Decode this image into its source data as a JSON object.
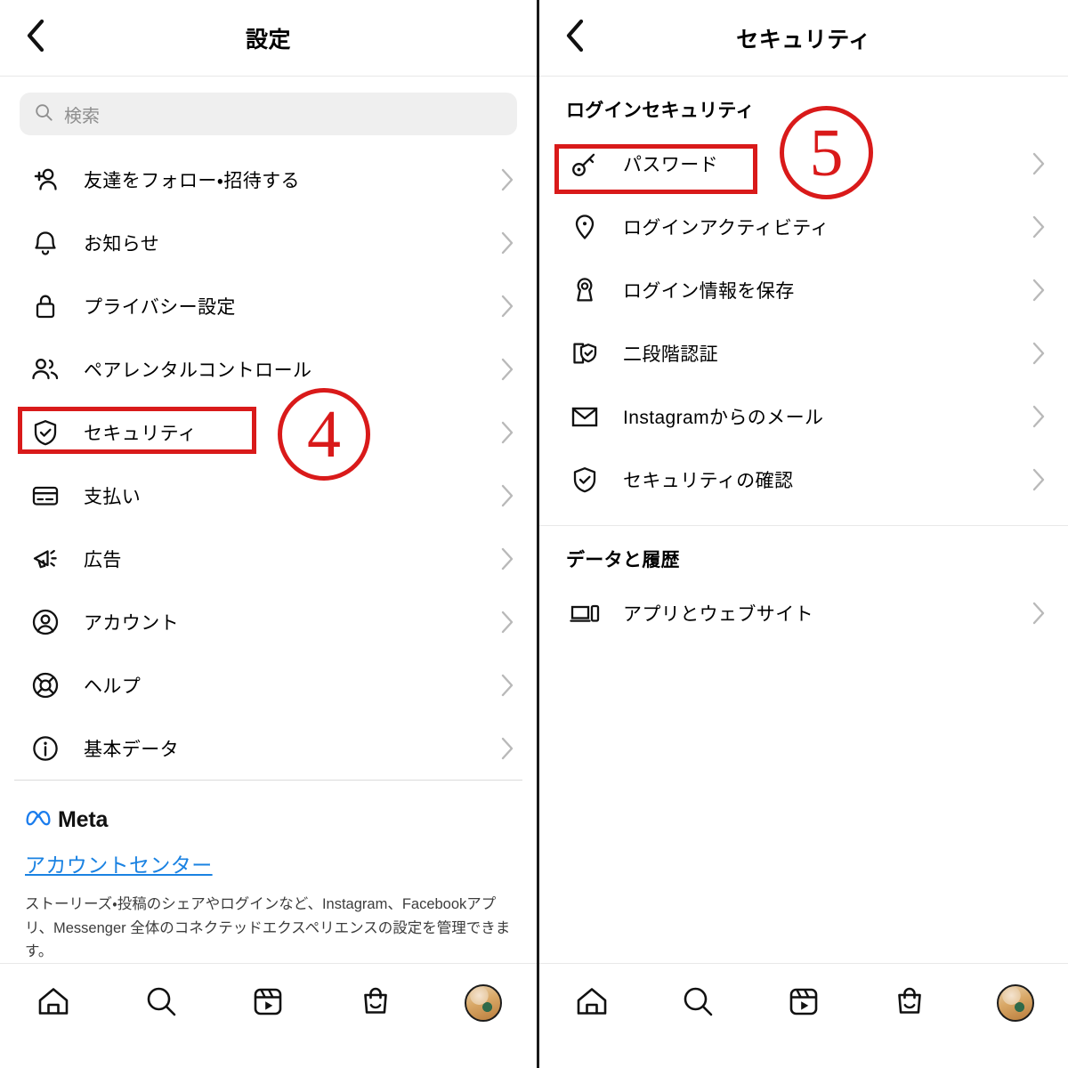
{
  "colors": {
    "annotation_red": "#d91a1a",
    "link_blue": "#1a82e2",
    "meta_blue": "#1a7ced",
    "search_bg": "#efefef",
    "placeholder": "#8e8e8e"
  },
  "left_screen": {
    "header": {
      "title": "設定",
      "back_icon": "chevron-left-icon"
    },
    "search": {
      "placeholder": "検索",
      "value": "",
      "icon": "search-icon"
    },
    "items": [
      {
        "label": "友達をフォロー・招待する",
        "icon": "person-add-icon"
      },
      {
        "label": "お知らせ",
        "icon": "bell-icon"
      },
      {
        "label": "プライバシー設定",
        "icon": "lock-icon"
      },
      {
        "label": "ペアレンタルコントロール",
        "icon": "people-icon"
      },
      {
        "label": "セキュリティ",
        "icon": "shield-check-icon"
      },
      {
        "label": "支払い",
        "icon": "credit-card-icon"
      },
      {
        "label": "広告",
        "icon": "megaphone-icon"
      },
      {
        "label": "アカウント",
        "icon": "account-circle-icon"
      },
      {
        "label": "ヘルプ",
        "icon": "life-ring-icon"
      },
      {
        "label": "基本データ",
        "icon": "info-circle-icon"
      }
    ],
    "meta_section": {
      "logo_icon": "meta-infinity-icon",
      "brand": "Meta",
      "link": "アカウントセンター",
      "description": "ストーリーズ・投稿のシェアやログインなど、Instagram、Facebookアプリ、Messenger 全体のコネクテッドエクスペリエンスの設定を管理できます。"
    },
    "annotations": {
      "highlight_label": "セキュリティ",
      "step_number": "4"
    }
  },
  "right_screen": {
    "header": {
      "title": "セキュリティ",
      "back_icon": "chevron-left-icon"
    },
    "sections": [
      {
        "title": "ログインセキュリティ",
        "items": [
          {
            "label": "パスワード",
            "icon": "key-icon"
          },
          {
            "label": "ログインアクティビティ",
            "icon": "location-pin-icon"
          },
          {
            "label": "ログイン情報を保存",
            "icon": "keyhole-icon"
          },
          {
            "label": "二段階認証",
            "icon": "phone-shield-icon"
          },
          {
            "label": "Instagramからのメール",
            "icon": "envelope-icon"
          },
          {
            "label": "セキュリティの確認",
            "icon": "shield-check-icon"
          }
        ]
      },
      {
        "title": "データと履歴",
        "items": [
          {
            "label": "アプリとウェブサイト",
            "icon": "laptop-phone-icon"
          }
        ]
      }
    ],
    "annotations": {
      "highlight_label": "パスワード",
      "step_number": "5"
    }
  },
  "tabbar": {
    "items": [
      {
        "name": "home",
        "icon": "home-icon"
      },
      {
        "name": "search",
        "icon": "search-icon"
      },
      {
        "name": "reels",
        "icon": "reels-icon"
      },
      {
        "name": "shop",
        "icon": "shop-bag-icon"
      },
      {
        "name": "profile",
        "icon": "avatar-icon"
      }
    ]
  }
}
